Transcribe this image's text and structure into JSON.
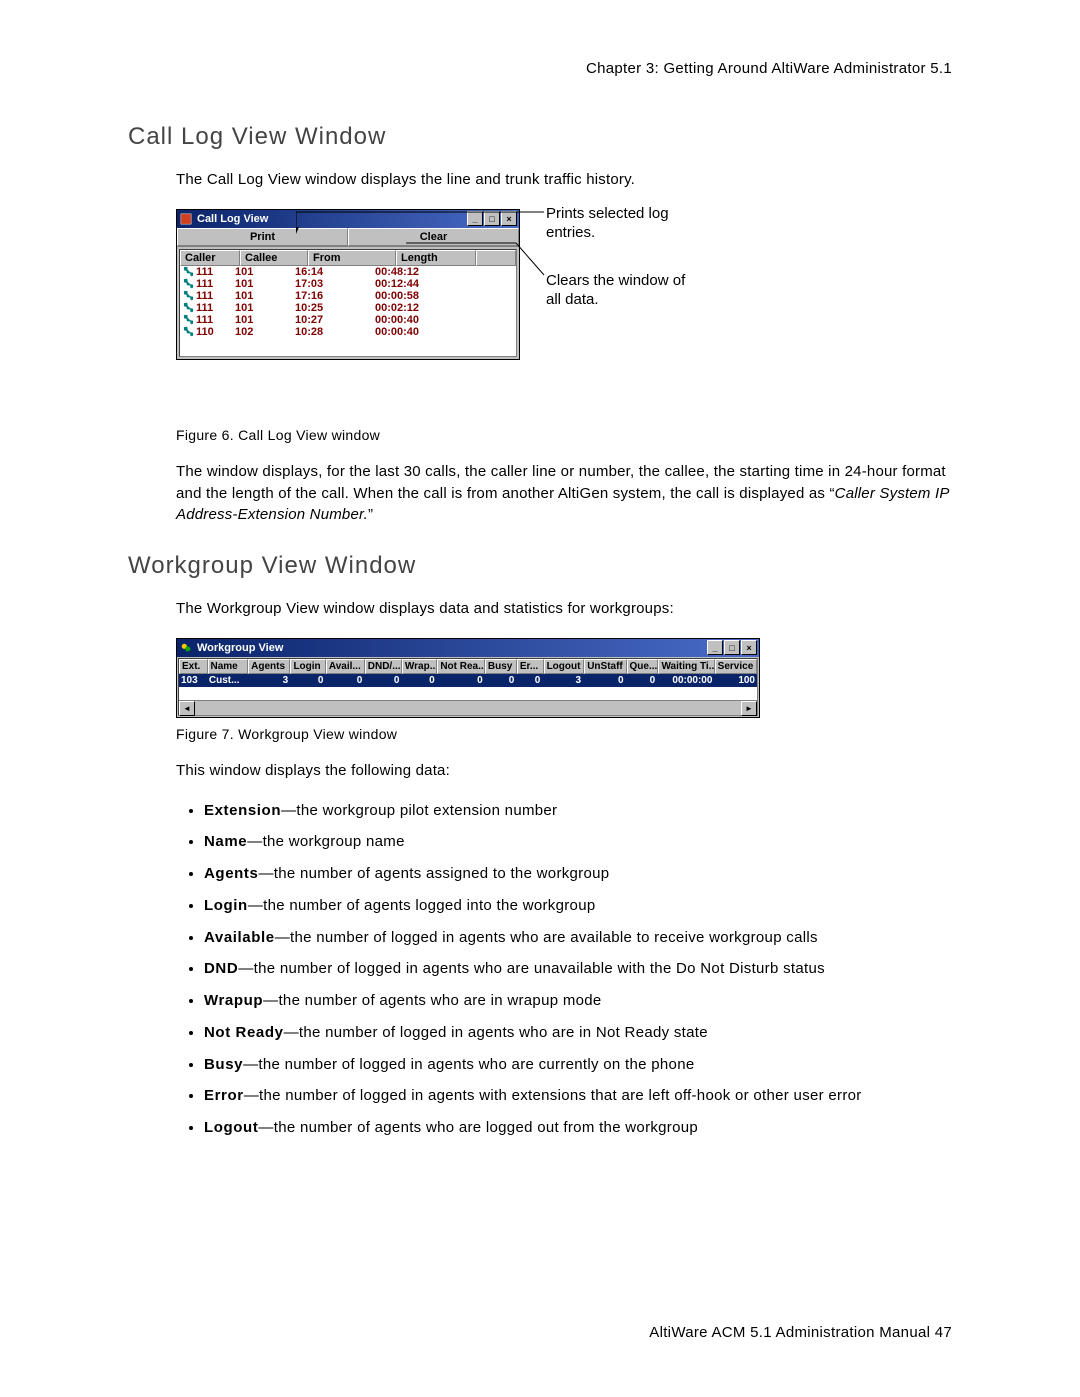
{
  "chapter_header": "Chapter 3:  Getting Around AltiWare Administrator 5.1",
  "section1": {
    "title": "Call Log View Window",
    "intro": "The Call Log View window displays the line and trunk traffic history.",
    "figure_caption": "Figure 6.   Call Log View window",
    "para": "The window displays, for the last 30 calls, the caller line or number, the callee, the starting time in 24-hour format and the length of the call. When the call is from another AltiGen system, the call is displayed as “",
    "para_italic": "Caller System IP Address-Extension Number.",
    "para_end": "”",
    "callout1": "Prints selected log entries.",
    "callout2": "Clears the window of all data.",
    "window": {
      "title": "Call Log View",
      "print": "Print",
      "clear": "Clear",
      "headers": {
        "caller": "Caller",
        "callee": "Callee",
        "from": "From",
        "length": "Length"
      },
      "rows": [
        {
          "caller": "111",
          "callee": "101",
          "from": "16:14",
          "length": "00:48:12"
        },
        {
          "caller": "111",
          "callee": "101",
          "from": "17:03",
          "length": "00:12:44"
        },
        {
          "caller": "111",
          "callee": "101",
          "from": "17:16",
          "length": "00:00:58"
        },
        {
          "caller": "111",
          "callee": "101",
          "from": "10:25",
          "length": "00:02:12"
        },
        {
          "caller": "111",
          "callee": "101",
          "from": "10:27",
          "length": "00:00:40"
        },
        {
          "caller": "110",
          "callee": "102",
          "from": "10:28",
          "length": "00:00:40"
        }
      ]
    }
  },
  "section2": {
    "title": "Workgroup View Window",
    "intro": "The Workgroup View window displays data and statistics for workgroups:",
    "figure_caption": "Figure 7.   Workgroup View window",
    "window": {
      "title": "Workgroup View",
      "headers": [
        "Ext.",
        "Name",
        "Agents",
        "Login",
        "Avail...",
        "DND/...",
        "Wrap...",
        "Not Rea...",
        "Busy",
        "Er...",
        "Logout",
        "UnStaff",
        "Que...",
        "Waiting Ti...",
        "Service"
      ],
      "row": [
        "103",
        "Cust...",
        "3",
        "0",
        "0",
        "0",
        "0",
        "0",
        "0",
        "0",
        "3",
        "0",
        "0",
        "00:00:00",
        "100"
      ]
    },
    "list_intro": "This window displays the following data:",
    "bullets": [
      {
        "term": "Extension",
        "desc": "—the workgroup pilot extension number"
      },
      {
        "term": "Name",
        "desc": "—the workgroup name"
      },
      {
        "term": "Agents",
        "desc": "—the number of agents assigned to the workgroup"
      },
      {
        "term": "Login",
        "desc": "—the number of agents logged into the workgroup"
      },
      {
        "term": "Available",
        "desc": "—the number of logged in agents who are available to receive workgroup calls"
      },
      {
        "term": "DND",
        "desc": "—the number of logged in agents who are unavailable with the Do Not Disturb status"
      },
      {
        "term": "Wrapup",
        "desc": "—the number of agents who are in wrapup mode"
      },
      {
        "term": "Not Ready",
        "desc": "—the number of logged in agents who are in Not Ready state"
      },
      {
        "term": "Busy",
        "desc": "—the number of logged in agents who are currently on the phone"
      },
      {
        "term": "Error",
        "desc": "—the number of logged in agents with extensions that are left off-hook or other user error"
      },
      {
        "term": "Logout",
        "desc": "—the number of agents who are logged out from the workgroup"
      }
    ]
  },
  "footer": "AltiWare ACM 5.1 Administration Manual   47"
}
